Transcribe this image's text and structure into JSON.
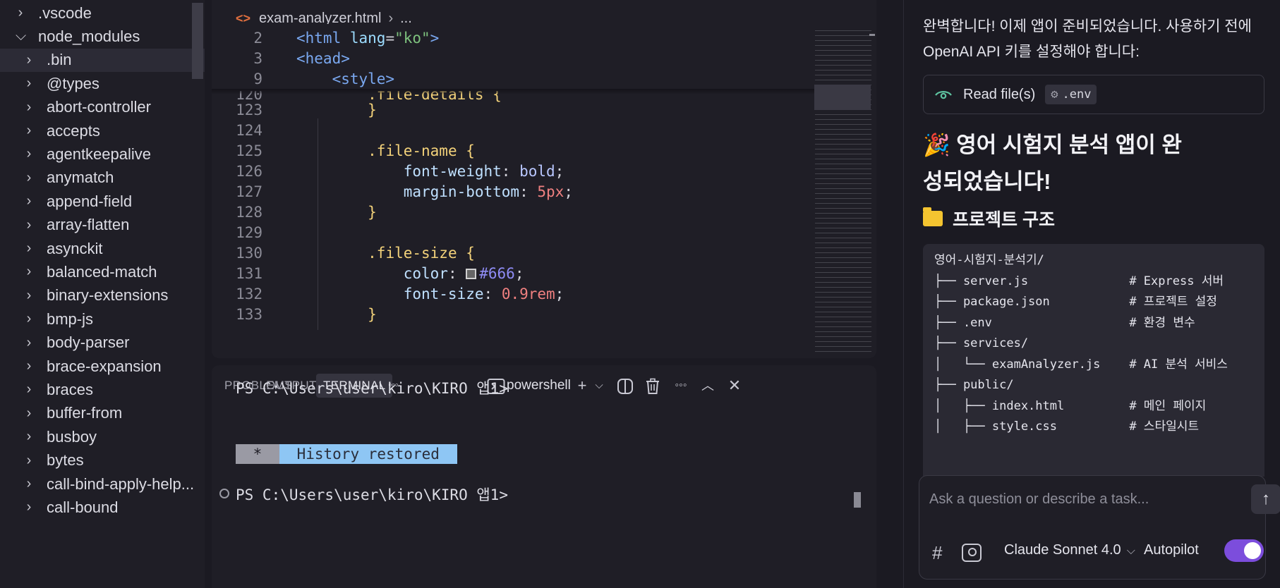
{
  "sidebar": {
    "items": [
      {
        "label": ".vscode",
        "expanded": false,
        "level": 0
      },
      {
        "label": "node_modules",
        "expanded": true,
        "level": 0
      },
      {
        "label": ".bin",
        "expanded": false,
        "level": 1,
        "selected": true
      },
      {
        "label": "@types",
        "expanded": false,
        "level": 1
      },
      {
        "label": "abort-controller",
        "expanded": false,
        "level": 1
      },
      {
        "label": "accepts",
        "expanded": false,
        "level": 1
      },
      {
        "label": "agentkeepalive",
        "expanded": false,
        "level": 1
      },
      {
        "label": "anymatch",
        "expanded": false,
        "level": 1
      },
      {
        "label": "append-field",
        "expanded": false,
        "level": 1
      },
      {
        "label": "array-flatten",
        "expanded": false,
        "level": 1
      },
      {
        "label": "asynckit",
        "expanded": false,
        "level": 1
      },
      {
        "label": "balanced-match",
        "expanded": false,
        "level": 1
      },
      {
        "label": "binary-extensions",
        "expanded": false,
        "level": 1
      },
      {
        "label": "bmp-js",
        "expanded": false,
        "level": 1
      },
      {
        "label": "body-parser",
        "expanded": false,
        "level": 1
      },
      {
        "label": "brace-expansion",
        "expanded": false,
        "level": 1
      },
      {
        "label": "braces",
        "expanded": false,
        "level": 1
      },
      {
        "label": "buffer-from",
        "expanded": false,
        "level": 1
      },
      {
        "label": "busboy",
        "expanded": false,
        "level": 1
      },
      {
        "label": "bytes",
        "expanded": false,
        "level": 1
      },
      {
        "label": "call-bind-apply-help...",
        "expanded": false,
        "level": 1
      },
      {
        "label": "call-bound",
        "expanded": false,
        "level": 1
      }
    ]
  },
  "editor": {
    "breadcrumb": {
      "file": "exam-analyzer.html",
      "rest": "..."
    },
    "sticky_lines": [
      {
        "num": "2",
        "indent": "",
        "tokens": [
          [
            "tag",
            "<html "
          ],
          [
            "attr",
            "lang"
          ],
          [
            "punc",
            "="
          ],
          [
            "str",
            "\"ko\""
          ],
          [
            "tag",
            ">"
          ]
        ]
      },
      {
        "num": "3",
        "indent": "",
        "tokens": [
          [
            "tag",
            "<head>"
          ]
        ]
      },
      {
        "num": "9",
        "indent": "    ",
        "tokens": [
          [
            "tag",
            "<style>"
          ]
        ]
      }
    ],
    "lines": [
      {
        "num": "120",
        "indent": "        ",
        "tokens": [
          [
            "sel",
            ".file-details "
          ],
          [
            "brace",
            "{"
          ]
        ]
      },
      {
        "num": "123",
        "indent": "        ",
        "tokens": [
          [
            "brace",
            "}"
          ]
        ]
      },
      {
        "num": "124",
        "indent": "",
        "tokens": []
      },
      {
        "num": "125",
        "indent": "        ",
        "tokens": [
          [
            "sel",
            ".file-name "
          ],
          [
            "brace",
            "{"
          ]
        ]
      },
      {
        "num": "126",
        "indent": "            ",
        "tokens": [
          [
            "prop",
            "font-weight"
          ],
          [
            "plain",
            ": "
          ],
          [
            "val",
            "bold"
          ],
          [
            "plain",
            ";"
          ]
        ]
      },
      {
        "num": "127",
        "indent": "            ",
        "tokens": [
          [
            "prop",
            "margin-bottom"
          ],
          [
            "plain",
            ": "
          ],
          [
            "num",
            "5px"
          ],
          [
            "plain",
            ";"
          ]
        ]
      },
      {
        "num": "128",
        "indent": "        ",
        "tokens": [
          [
            "brace",
            "}"
          ]
        ]
      },
      {
        "num": "129",
        "indent": "",
        "tokens": []
      },
      {
        "num": "130",
        "indent": "        ",
        "tokens": [
          [
            "sel",
            ".file-size "
          ],
          [
            "brace",
            "{"
          ]
        ]
      },
      {
        "num": "131",
        "indent": "            ",
        "tokens": [
          [
            "prop",
            "color"
          ],
          [
            "plain",
            ": "
          ],
          [
            "swatch",
            "#666"
          ],
          [
            "hex",
            "#666"
          ],
          [
            "plain",
            ";"
          ]
        ]
      },
      {
        "num": "132",
        "indent": "            ",
        "tokens": [
          [
            "prop",
            "font-size"
          ],
          [
            "plain",
            ": "
          ],
          [
            "num",
            "0.9rem"
          ],
          [
            "plain",
            ";"
          ]
        ]
      },
      {
        "num": "133",
        "indent": "        ",
        "tokens": [
          [
            "brace",
            "}"
          ]
        ]
      }
    ]
  },
  "panel": {
    "tabs": [
      "PROBLEMS",
      "OUTPUT",
      "TERMINAL"
    ],
    "active_tab": "TERMINAL",
    "more_label": "◦◦◦",
    "shell_label": "powershell",
    "terminal": {
      "prompt1": "PS C:\\Users\\user\\kiro\\KIRO 앱1>",
      "history_star": " * ",
      "history_text": " History restored ",
      "prompt2": "PS C:\\Users\\user\\kiro\\KIRO 앱1>"
    }
  },
  "chat": {
    "intro": "완벽합니다! 이제 앱이 준비되었습니다. 사용하기 전에 OpenAI API 키를 설정해야 합니다:",
    "read_file_label": "Read file(s)",
    "read_file_chip": ".env",
    "heading_emoji": "🎉",
    "heading": "영어 시험지 분석 앱이 완성되었습니다!",
    "project_heading": "프로젝트 구조",
    "tree_lines": [
      "영어-시험지-분석기/",
      "├── server.js              # Express 서버",
      "├── package.json           # 프로젝트 설정",
      "├── .env                   # 환경 변수",
      "├── services/",
      "│   └── examAnalyzer.js    # AI 분석 서비스",
      "├── public/",
      "│   ├── index.html         # 메인 페이지",
      "│   ├── style.css          # 스타일시트"
    ],
    "input_placeholder": "Ask a question or describe a task...",
    "model": "Claude Sonnet 4.0",
    "autopilot_label": "Autopilot",
    "autopilot_on": true
  }
}
